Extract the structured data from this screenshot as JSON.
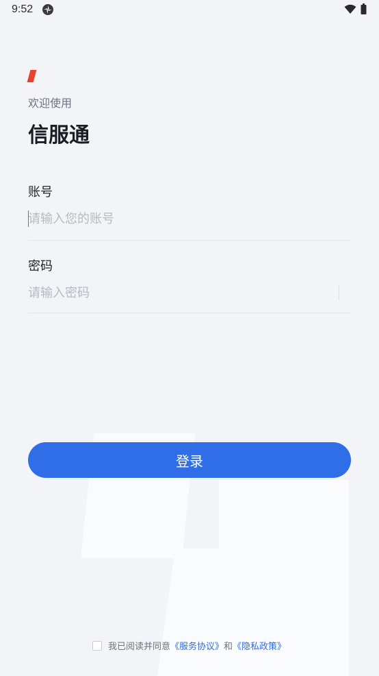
{
  "status_bar": {
    "time": "9:52",
    "app_icon": "app-status-icon",
    "wifi_icon": "wifi-icon",
    "battery_icon": "battery-icon"
  },
  "header": {
    "welcome": "欢迎使用",
    "title": "信服通"
  },
  "form": {
    "account_label": "账号",
    "account_placeholder": "请输入您的账号",
    "password_label": "密码",
    "password_placeholder": "请输入密码"
  },
  "login_button": "登录",
  "agreement": {
    "text": "我已阅读并同意",
    "service_link": "《服务协议》",
    "conjunction": "和",
    "privacy_link": "《隐私政策》"
  },
  "colors": {
    "accent": "#2f6ee6",
    "brand_mark": "#e8432f",
    "background": "#f3f4f8"
  }
}
